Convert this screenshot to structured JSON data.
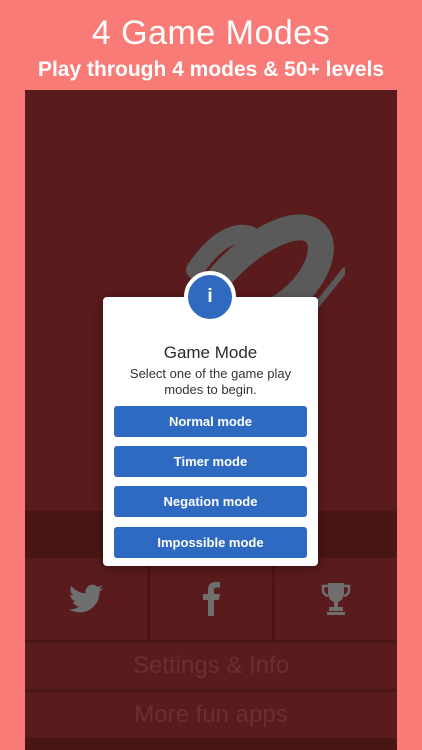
{
  "header": {
    "title": "4 Game Modes",
    "subtitle": "Play through 4 modes & 50+ levels"
  },
  "modal": {
    "badge": "i",
    "title": "Game Mode",
    "description": "Select one of the game play modes to begin.",
    "buttons": [
      "Normal mode",
      "Timer mode",
      "Negation mode",
      "Impossible mode"
    ]
  },
  "menu": {
    "settings": "Settings & Info",
    "more_apps": "More fun apps"
  },
  "icons": [
    "twitter-icon",
    "facebook-icon",
    "trophy-icon"
  ],
  "colors": {
    "page_bg": "#f97b77",
    "app_bg": "#591b1b",
    "button": "#2e6ac1"
  }
}
